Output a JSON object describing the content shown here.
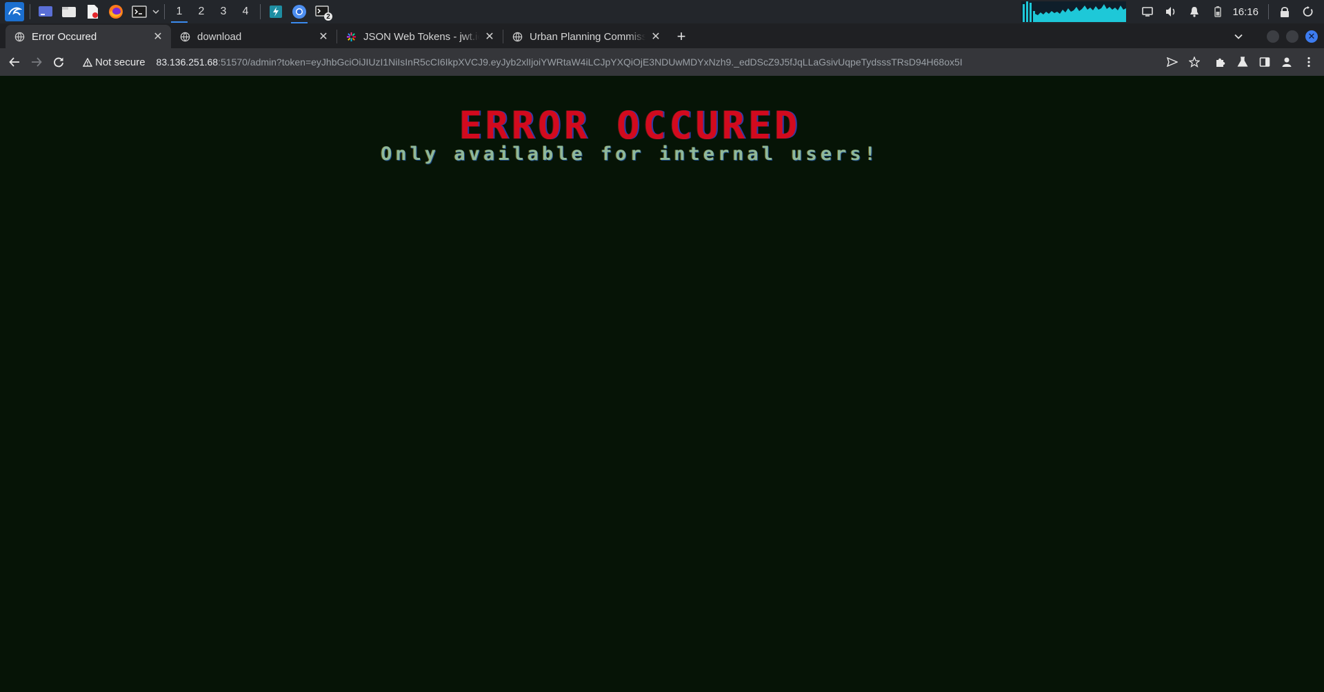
{
  "taskbar": {
    "workspaces": [
      "1",
      "2",
      "3",
      "4"
    ],
    "active_workspace": "1",
    "clock": "16:16",
    "terminal_badge": "2",
    "apps": [
      "kali-menu-icon",
      "desktop-icon",
      "file-manager-icon",
      "text-editor-icon",
      "firefox-icon",
      "terminal-icon",
      "burp-icon",
      "chromium-icon",
      "terminal-badge-icon"
    ],
    "cpu_graph_color": "#1ec8d8"
  },
  "tabs": [
    {
      "title": "Error Occured",
      "active": true
    },
    {
      "title": "download",
      "active": false
    },
    {
      "title": "JSON Web Tokens - jwt.io",
      "active": false
    },
    {
      "title": "Urban Planning Commission",
      "active": false
    }
  ],
  "toolbar": {
    "security_label": "Not secure",
    "url_host": "83.136.251.68",
    "url_rest": ":51570/admin?token=eyJhbGciOiJIUzI1NiIsInR5cCI6IkpXVCJ9.eyJyb2xlIjoiYWRtaW4iLCJpYXQiOjE3NDUwMDYxNzh9._edDScZ9J5fJqLLaGsivUqpeTydsssTRsD94H68ox5I"
  },
  "page": {
    "title": "ERROR OCCURED",
    "subtitle": "Only available for internal users!",
    "background": "#061406",
    "title_color": "#d20a1e",
    "subtitle_color": "#8fb89a"
  }
}
